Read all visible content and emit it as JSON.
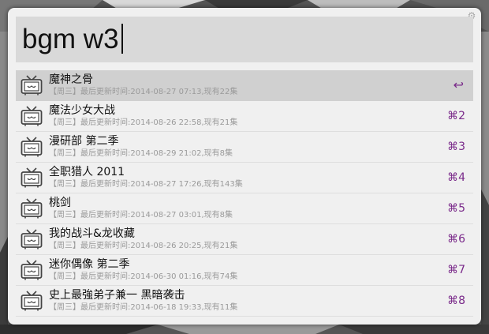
{
  "search": {
    "query": "bgm w3"
  },
  "colors": {
    "accent": "#7a2a8a",
    "selected_row": "#d0d0d0",
    "search_bg": "#d9d9d9"
  },
  "icons": {
    "result_icon": "tv-icon",
    "settings": "gear-icon"
  },
  "results": [
    {
      "title": "魔神之骨",
      "subtitle": "【周三】最后更新时间:2014-08-27 07:13,现有22集",
      "shortcut": "↩"
    },
    {
      "title": "魔法少女大战",
      "subtitle": "【周三】最后更新时间:2014-08-26 22:58,现有21集",
      "shortcut": "⌘2"
    },
    {
      "title": "漫研部 第二季",
      "subtitle": "【周三】最后更新时间:2014-08-29 21:02,现有8集",
      "shortcut": "⌘3"
    },
    {
      "title": "全职猎人 2011",
      "subtitle": "【周三】最后更新时间:2014-08-27 17:26,现有143集",
      "shortcut": "⌘4"
    },
    {
      "title": "桃剑",
      "subtitle": "【周三】最后更新时间:2014-08-27 03:01,现有8集",
      "shortcut": "⌘5"
    },
    {
      "title": "我的战斗&龙收藏",
      "subtitle": "【周三】最后更新时间:2014-08-26 20:25,现有21集",
      "shortcut": "⌘6"
    },
    {
      "title": "迷你偶像 第二季",
      "subtitle": "【周三】最后更新时间:2014-06-30 01:16,现有74集",
      "shortcut": "⌘7"
    },
    {
      "title": "史上最強弟子兼一 黑暗袭击",
      "subtitle": "【周三】最后更新时间:2014-06-18 19:33,现有11集",
      "shortcut": "⌘8"
    }
  ]
}
